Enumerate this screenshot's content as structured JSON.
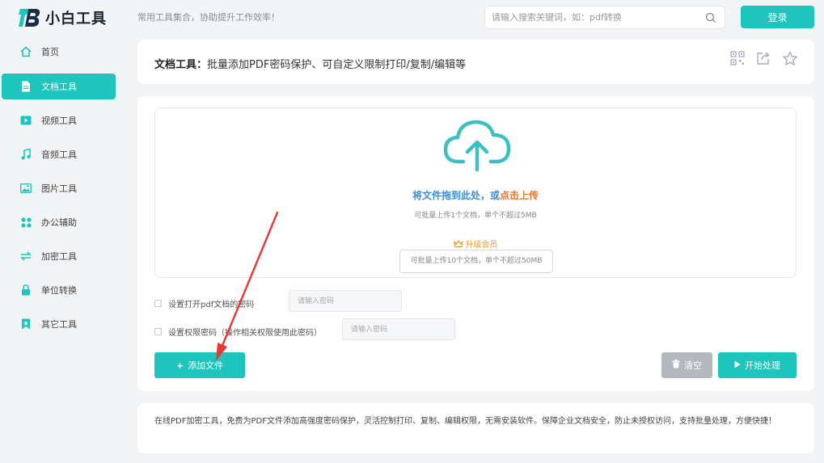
{
  "header": {
    "logo_text": "小白工具",
    "slogan": "常用工具集合，协助提升工作效率！",
    "search_placeholder": "请输入搜索关键词，如：pdf转换",
    "login_label": "登录"
  },
  "sidebar": {
    "items": [
      {
        "label": "首页",
        "icon": "home-icon"
      },
      {
        "label": "文档工具",
        "icon": "document-icon",
        "active": true
      },
      {
        "label": "视频工具",
        "icon": "video-icon"
      },
      {
        "label": "音频工具",
        "icon": "music-icon"
      },
      {
        "label": "图片工具",
        "icon": "image-icon"
      },
      {
        "label": "办公辅助",
        "icon": "grid-icon"
      },
      {
        "label": "加密工具",
        "icon": "swap-icon"
      },
      {
        "label": "单位转换",
        "icon": "lock-icon"
      },
      {
        "label": "其它工具",
        "icon": "bookmark-icon"
      }
    ]
  },
  "title_card": {
    "category": "文档工具：",
    "title": "批量添加PDF密码保护、可自定义限制打印/复制/编辑等",
    "icons": [
      "qrcode-icon",
      "share-icon",
      "star-icon"
    ]
  },
  "upload": {
    "drop_text": "将文件拖到此处，或",
    "click_text": "点击上传",
    "limit_text": "可批量上传1个文档，单个不超过5MB",
    "vip_label": "升级会员",
    "vip_limit_text": "可批量上传10个文档，单个不超过50MB"
  },
  "options": {
    "open_password_label": "设置打开pdf文档的密码",
    "open_password_placeholder": "请输入密码",
    "perm_password_label": "设置权限密码（操作相关权限使用此密码）",
    "perm_password_placeholder": "请输入密码"
  },
  "buttons": {
    "add_label": "添加文件",
    "clear_label": "清空",
    "start_label": "开始处理"
  },
  "description": "在线PDF加密工具，免费为PDF文件添加高强度密码保护，灵活控制打印、复制、编辑权限，无需安装软件。保障企业文档安全，防止未授权访问，支持批量处理，方便快捷！",
  "colors": {
    "accent": "#1dc5bd",
    "link_blue": "#3b8fd9",
    "link_orange": "#f0742a",
    "annotation_arrow": "#e53935"
  }
}
